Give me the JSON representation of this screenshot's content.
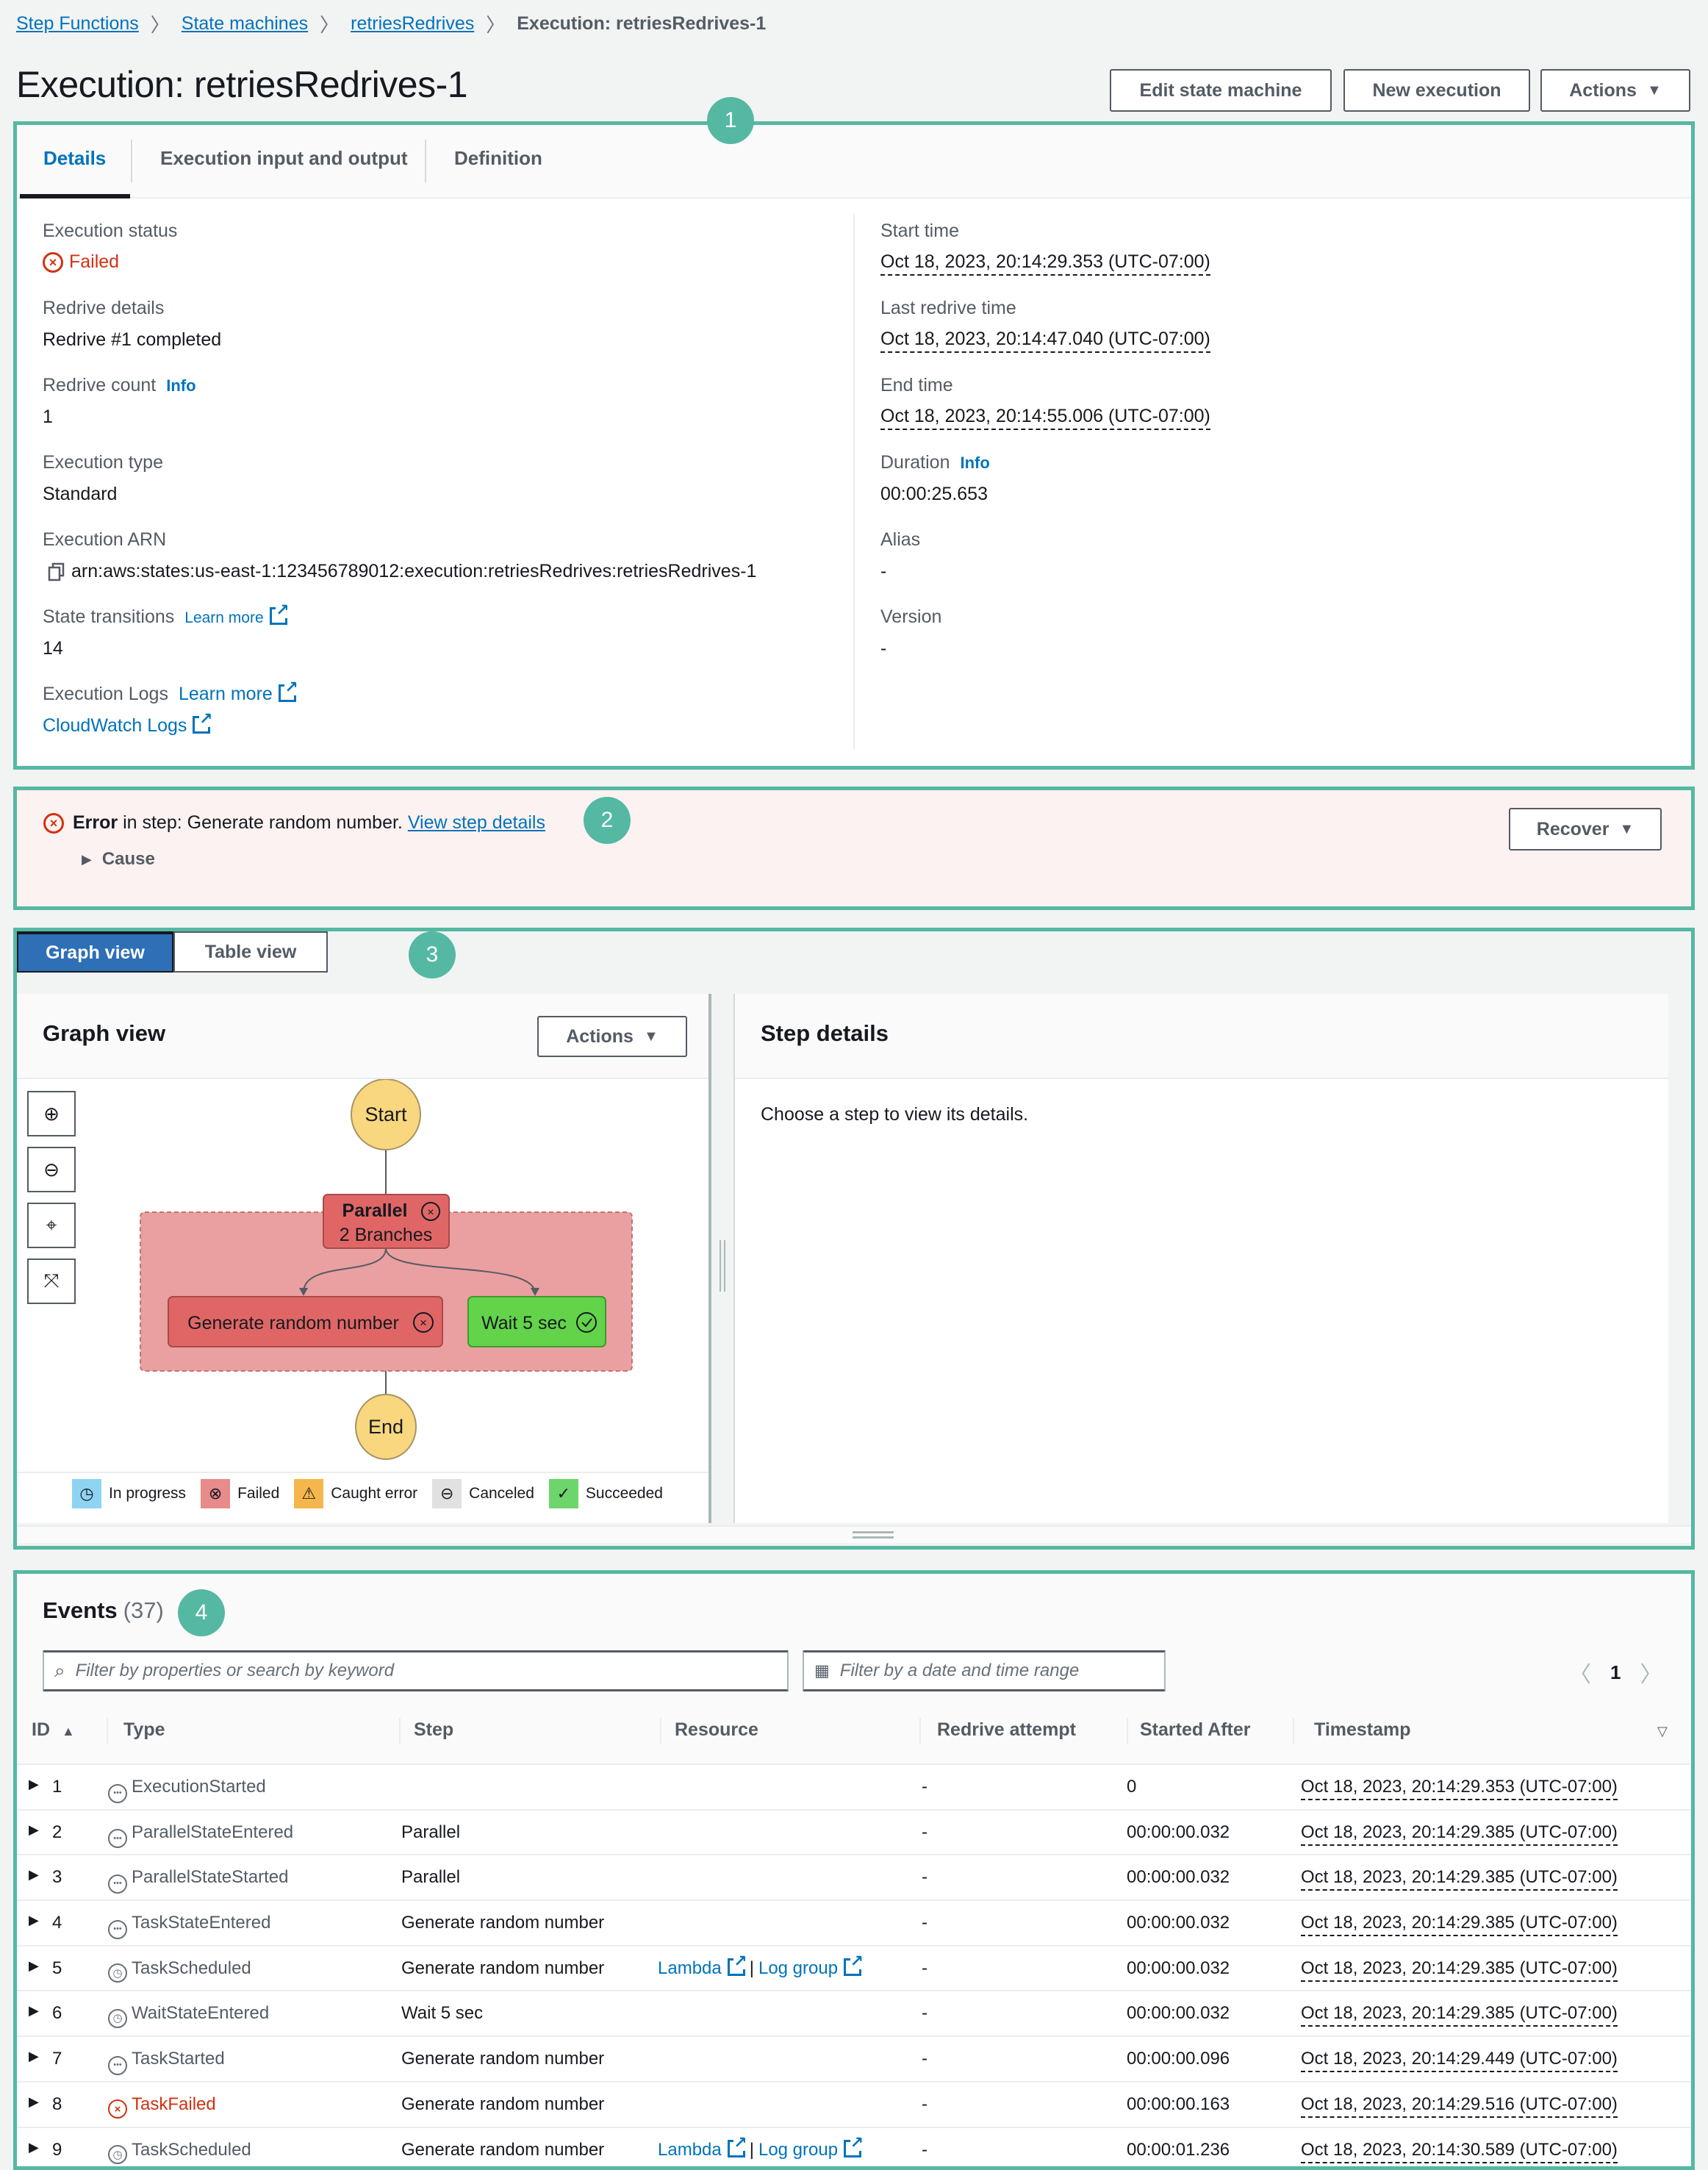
{
  "breadcrumb": [
    {
      "label": "Step Functions"
    },
    {
      "label": "State machines"
    },
    {
      "label": "retriesRedrives"
    }
  ],
  "breadcrumb_current": "Execution: retriesRedrives-1",
  "page_title": "Execution: retriesRedrives-1",
  "header_buttons": {
    "edit": "Edit state machine",
    "new_execution": "New execution",
    "actions": "Actions"
  },
  "annotations": [
    "1",
    "2",
    "3",
    "4"
  ],
  "tabs": [
    {
      "label": "Details",
      "active": true
    },
    {
      "label": "Execution input and output",
      "active": false
    },
    {
      "label": "Definition",
      "active": false
    }
  ],
  "details": {
    "execution_status": {
      "label": "Execution status",
      "value": "Failed"
    },
    "redrive_details": {
      "label": "Redrive details",
      "value": "Redrive #1 completed"
    },
    "redrive_count": {
      "label": "Redrive count",
      "info": "Info",
      "value": "1"
    },
    "execution_type": {
      "label": "Execution type",
      "value": "Standard"
    },
    "execution_arn": {
      "label": "Execution ARN",
      "value": "arn:aws:states:us-east-1:123456789012:execution:retriesRedrives:retriesRedrives-1"
    },
    "state_transitions": {
      "label": "State transitions",
      "link": "Learn more",
      "value": "14"
    },
    "execution_logs": {
      "label": "Execution Logs",
      "link": "Learn more",
      "value": "CloudWatch Logs"
    },
    "start_time": {
      "label": "Start time",
      "value": "Oct 18, 2023, 20:14:29.353 (UTC-07:00)"
    },
    "last_redrive_time": {
      "label": "Last redrive time",
      "value": "Oct 18, 2023, 20:14:47.040 (UTC-07:00)"
    },
    "end_time": {
      "label": "End time",
      "value": "Oct 18, 2023, 20:14:55.006 (UTC-07:00)"
    },
    "duration": {
      "label": "Duration",
      "info": "Info",
      "value": "00:00:25.653"
    },
    "alias": {
      "label": "Alias",
      "value": "-"
    },
    "version": {
      "label": "Version",
      "value": "-"
    }
  },
  "error_banner": {
    "bold": "Error",
    "text": " in step: Generate random number. ",
    "link": "View step details",
    "cause": "Cause",
    "recover_button": "Recover"
  },
  "view_toggle": {
    "graph": "Graph view",
    "table": "Table view"
  },
  "graph_view": {
    "title": "Graph view",
    "actions": "Actions",
    "nodes": {
      "start": "Start",
      "parallel_title": "Parallel",
      "parallel_sub": "2 Branches",
      "generate": "Generate random number",
      "wait": "Wait 5 sec",
      "end": "End"
    },
    "legend": [
      {
        "label": "In progress",
        "color": "#8fd3f2",
        "icon": "clock-icon"
      },
      {
        "label": "Failed",
        "color": "#e88b8b",
        "icon": "x-circle-icon"
      },
      {
        "label": "Caught error",
        "color": "#f5b74b",
        "icon": "warning-icon"
      },
      {
        "label": "Canceled",
        "color": "#e1e1e1",
        "icon": "minus-circle-icon"
      },
      {
        "label": "Succeeded",
        "color": "#6cd66c",
        "icon": "check-circle-icon"
      }
    ]
  },
  "step_details": {
    "title": "Step details",
    "empty": "Choose a step to view its details."
  },
  "events": {
    "title": "Events",
    "count": "(37)",
    "search_placeholder": "Filter by properties or search by keyword",
    "date_placeholder": "Filter by a date and time range",
    "page": "1",
    "columns": [
      "ID",
      "Type",
      "Step",
      "Resource",
      "Redrive attempt",
      "Started After",
      "Timestamp"
    ],
    "rows": [
      {
        "id": "1",
        "type": "ExecutionStarted",
        "icon": "dots",
        "step": "",
        "resource": false,
        "redrive": "-",
        "started_after": "0",
        "timestamp": "Oct 18, 2023, 20:14:29.353 (UTC-07:00)"
      },
      {
        "id": "2",
        "type": "ParallelStateEntered",
        "icon": "dots",
        "step": "Parallel",
        "resource": false,
        "redrive": "-",
        "started_after": "00:00:00.032",
        "timestamp": "Oct 18, 2023, 20:14:29.385 (UTC-07:00)"
      },
      {
        "id": "3",
        "type": "ParallelStateStarted",
        "icon": "dots",
        "step": "Parallel",
        "resource": false,
        "redrive": "-",
        "started_after": "00:00:00.032",
        "timestamp": "Oct 18, 2023, 20:14:29.385 (UTC-07:00)"
      },
      {
        "id": "4",
        "type": "TaskStateEntered",
        "icon": "dots",
        "step": "Generate random number",
        "resource": false,
        "redrive": "-",
        "started_after": "00:00:00.032",
        "timestamp": "Oct 18, 2023, 20:14:29.385 (UTC-07:00)"
      },
      {
        "id": "5",
        "type": "TaskScheduled",
        "icon": "clock",
        "step": "Generate random number",
        "resource": true,
        "redrive": "-",
        "started_after": "00:00:00.032",
        "timestamp": "Oct 18, 2023, 20:14:29.385 (UTC-07:00)"
      },
      {
        "id": "6",
        "type": "WaitStateEntered",
        "icon": "clock",
        "step": "Wait 5 sec",
        "resource": false,
        "redrive": "-",
        "started_after": "00:00:00.032",
        "timestamp": "Oct 18, 2023, 20:14:29.385 (UTC-07:00)"
      },
      {
        "id": "7",
        "type": "TaskStarted",
        "icon": "dots",
        "step": "Generate random number",
        "resource": false,
        "redrive": "-",
        "started_after": "00:00:00.096",
        "timestamp": "Oct 18, 2023, 20:14:29.449 (UTC-07:00)"
      },
      {
        "id": "8",
        "type": "TaskFailed",
        "icon": "fail",
        "step": "Generate random number",
        "resource": false,
        "redrive": "-",
        "started_after": "00:00:00.163",
        "timestamp": "Oct 18, 2023, 20:14:29.516 (UTC-07:00)"
      },
      {
        "id": "9",
        "type": "TaskScheduled",
        "icon": "clock",
        "step": "Generate random number",
        "resource": true,
        "redrive": "-",
        "started_after": "00:00:01.236",
        "timestamp": "Oct 18, 2023, 20:14:30.589 (UTC-07:00)"
      }
    ],
    "resource_links": {
      "lambda": "Lambda",
      "separator": "|",
      "log_group": "Log group"
    }
  },
  "colors": {
    "annotation": "#55b8a3",
    "link": "#0073bb",
    "failed": "#d13212",
    "failed_node": "#e06666",
    "parallel_group": "#eaa0a0",
    "succeeded_node": "#63d34a",
    "start_end": "#f8d77e",
    "primary_toggle": "#2e6fb6"
  }
}
